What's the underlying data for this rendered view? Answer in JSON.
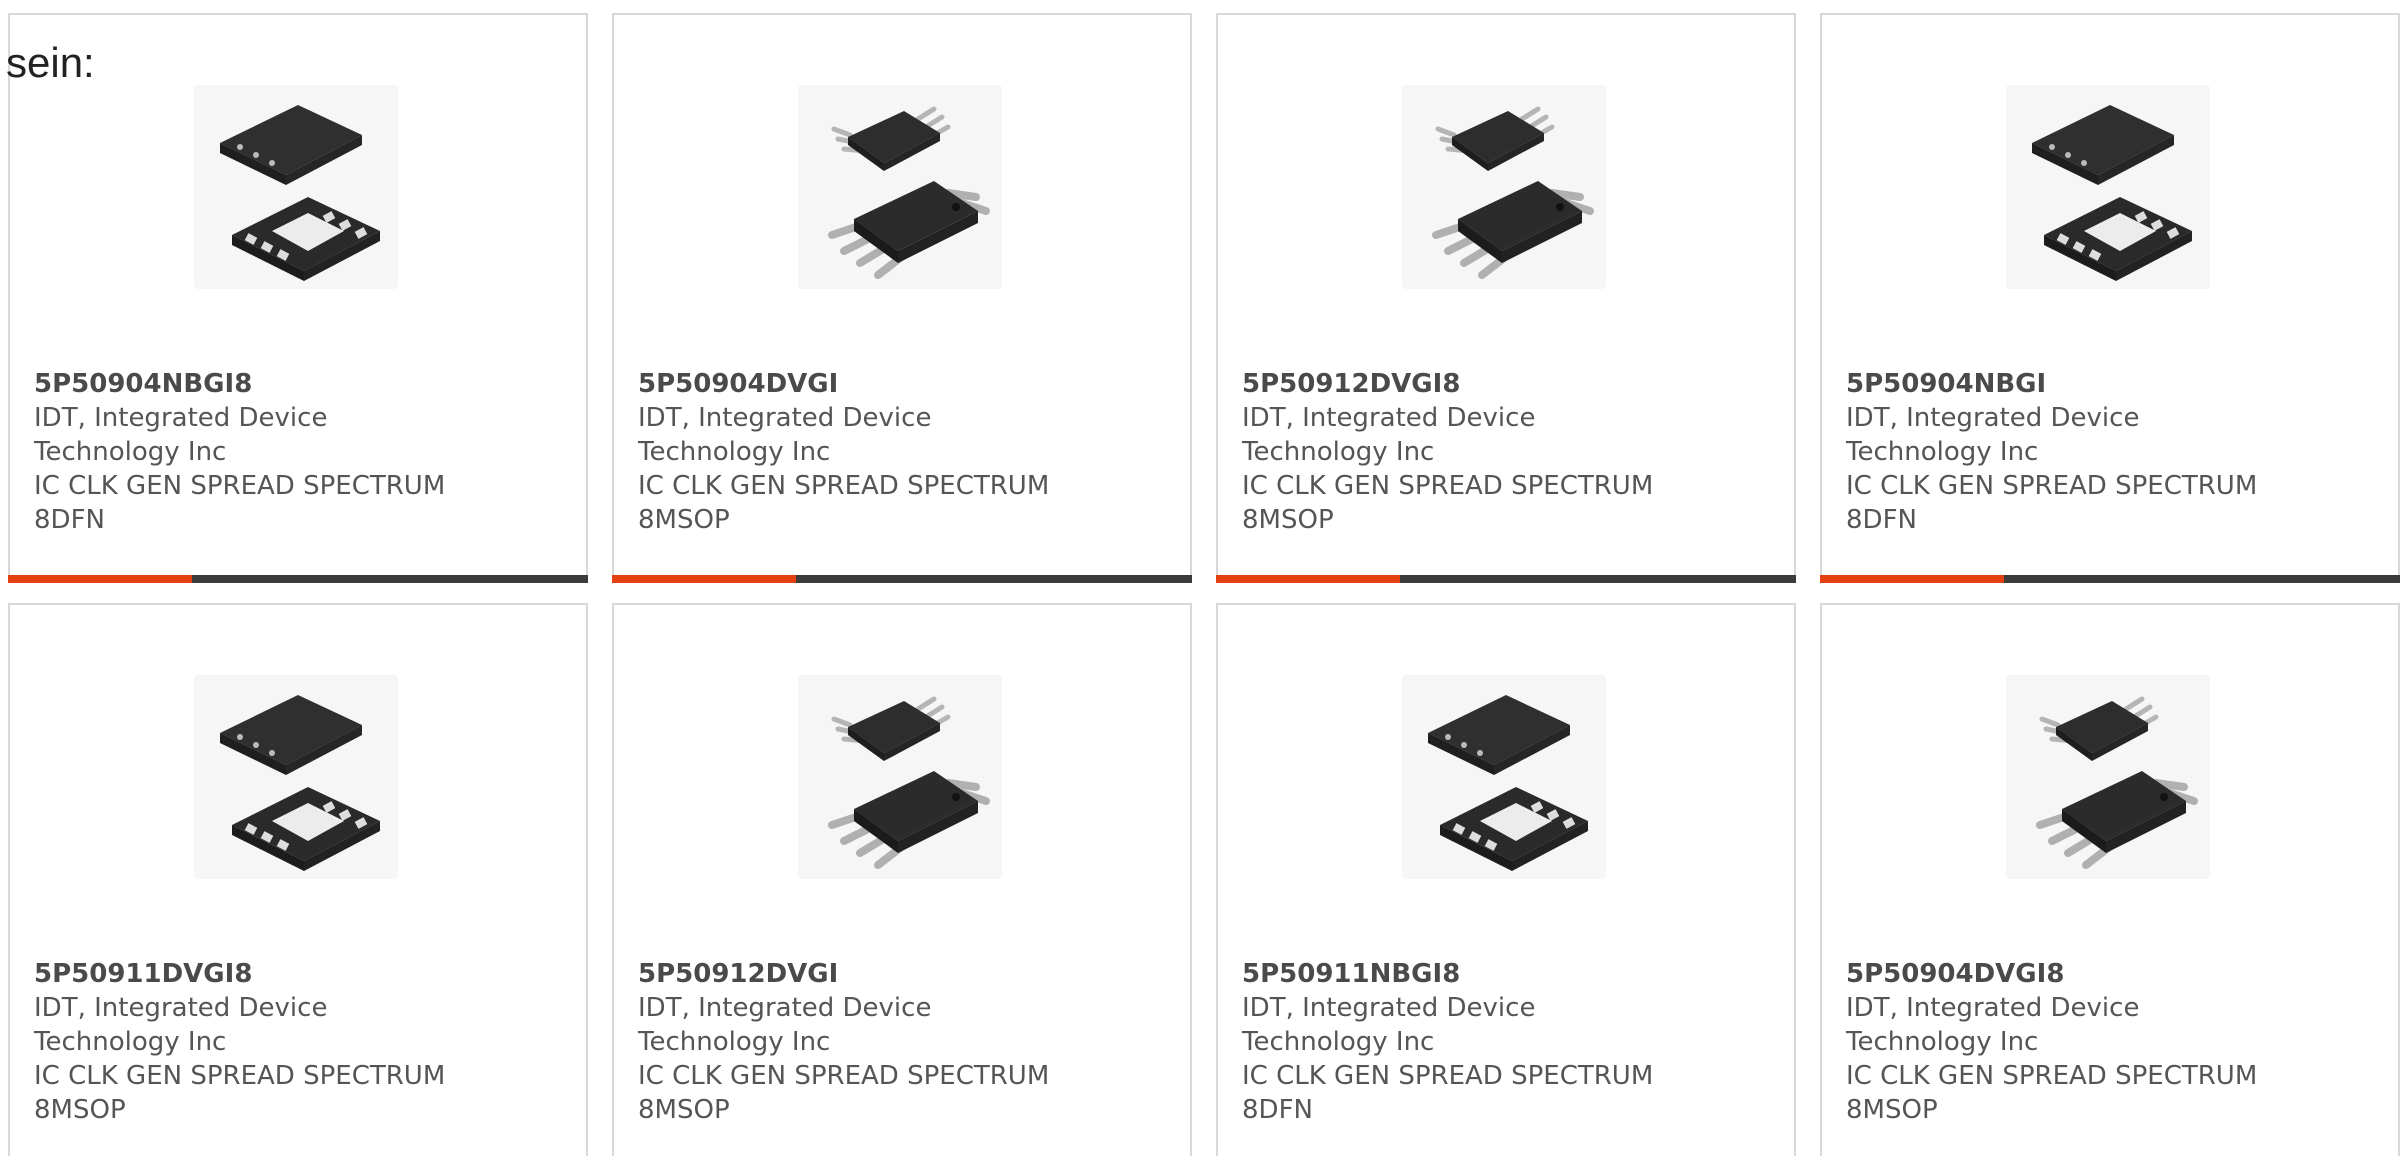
{
  "prefix_text": "sein:",
  "products": [
    {
      "part_number": "5P50904NBGI8",
      "manufacturer": "IDT, Integrated Device Technology Inc",
      "description": "IC CLK GEN SPREAD SPECTRUM 8DFN",
      "package": "dfn",
      "has_bar": true
    },
    {
      "part_number": "5P50904DVGI",
      "manufacturer": "IDT, Integrated Device Technology Inc",
      "description": "IC CLK GEN SPREAD SPECTRUM 8MSOP",
      "package": "msop",
      "has_bar": true
    },
    {
      "part_number": "5P50912DVGI8",
      "manufacturer": "IDT, Integrated Device Technology Inc",
      "description": "IC CLK GEN SPREAD SPECTRUM 8MSOP",
      "package": "msop",
      "has_bar": true
    },
    {
      "part_number": "5P50904NBGI",
      "manufacturer": "IDT, Integrated Device Technology Inc",
      "description": "IC CLK GEN SPREAD SPECTRUM 8DFN",
      "package": "dfn",
      "has_bar": true
    },
    {
      "part_number": "5P50911DVGI8",
      "manufacturer": "IDT, Integrated Device Technology Inc",
      "description": "IC CLK GEN SPREAD SPECTRUM 8MSOP",
      "package": "dfn",
      "has_bar": false
    },
    {
      "part_number": "5P50912DVGI",
      "manufacturer": "IDT, Integrated Device Technology Inc",
      "description": "IC CLK GEN SPREAD SPECTRUM 8MSOP",
      "package": "msop",
      "has_bar": false
    },
    {
      "part_number": "5P50911NBGI8",
      "manufacturer": "IDT, Integrated Device Technology Inc",
      "description": "IC CLK GEN SPREAD SPECTRUM 8DFN",
      "package": "dfn",
      "has_bar": false
    },
    {
      "part_number": "5P50904DVGI8",
      "manufacturer": "IDT, Integrated Device Technology Inc",
      "description": "IC CLK GEN SPREAD SPECTRUM 8MSOP",
      "package": "msop",
      "has_bar": false
    }
  ],
  "colors": {
    "accent": "#e2400f",
    "bar": "#3b3b3b",
    "border": "#d9d9d9",
    "text": "#555555"
  }
}
